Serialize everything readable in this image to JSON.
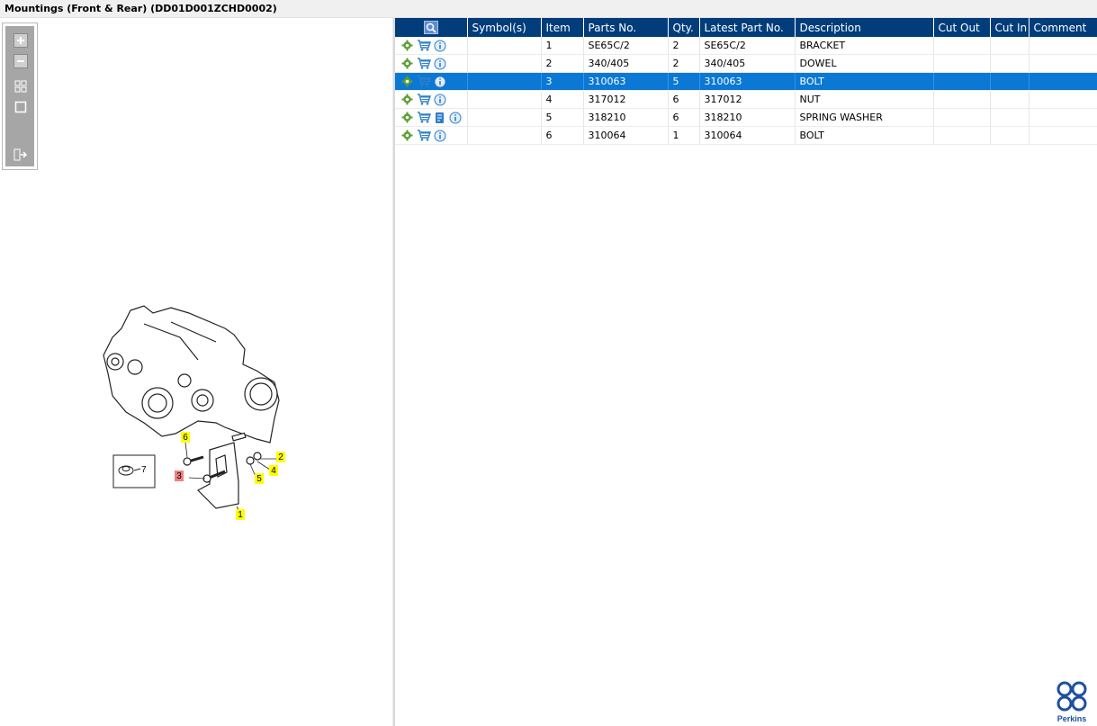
{
  "window": {
    "title": "Mountings (Front & Rear) (DD01D001ZCHD0002)"
  },
  "toolbar": {
    "buttons": [
      {
        "name": "zoom-in",
        "icon": "plus-icon"
      },
      {
        "name": "zoom-out",
        "icon": "minus-icon"
      },
      {
        "name": "fit-all",
        "icon": "grid-icon"
      },
      {
        "name": "actual-size",
        "icon": "square-icon"
      },
      {
        "name": "export",
        "icon": "export-icon"
      }
    ]
  },
  "diagram": {
    "callouts": [
      "1",
      "2",
      "3",
      "4",
      "5",
      "6",
      "7"
    ],
    "highlight_color": "#ffff00",
    "selected_callout_color": "#f08080"
  },
  "table": {
    "headers": [
      "",
      "Symbol(s)",
      "Item",
      "Parts No.",
      "Qty.",
      "Latest Part No.",
      "Description",
      "Cut Out",
      "Cut In",
      "Comment"
    ],
    "rows": [
      {
        "item": "1",
        "parts_no": "SE65C/2",
        "qty": "2",
        "latest": "SE65C/2",
        "description": "BRACKET",
        "extra_icon": false,
        "selected": false
      },
      {
        "item": "2",
        "parts_no": "340/405",
        "qty": "2",
        "latest": "340/405",
        "description": "DOWEL",
        "extra_icon": false,
        "selected": false
      },
      {
        "item": "3",
        "parts_no": "310063",
        "qty": "5",
        "latest": "310063",
        "description": "BOLT",
        "extra_icon": false,
        "selected": true
      },
      {
        "item": "4",
        "parts_no": "317012",
        "qty": "6",
        "latest": "317012",
        "description": "NUT",
        "extra_icon": false,
        "selected": false
      },
      {
        "item": "5",
        "parts_no": "318210",
        "qty": "6",
        "latest": "318210",
        "description": "SPRING WASHER",
        "extra_icon": true,
        "selected": false
      },
      {
        "item": "6",
        "parts_no": "310064",
        "qty": "1",
        "latest": "310064",
        "description": "BOLT",
        "extra_icon": false,
        "selected": false
      }
    ]
  },
  "colors": {
    "header_bg": "#003d7a",
    "selected_row": "#0a78d4",
    "accent_green": "#5a9e2f",
    "brand": "#1f4fa0"
  },
  "brand": {
    "name": "Perkins"
  }
}
